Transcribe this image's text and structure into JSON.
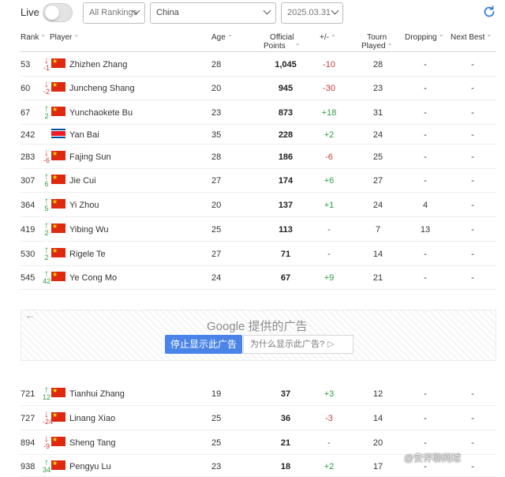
{
  "top": {
    "live_label": "Live",
    "rankings_select": "All Rankings",
    "country_select": "China",
    "date_select": "2025.03.31"
  },
  "headers": {
    "rank": "Rank",
    "player": "Player",
    "age": "Age",
    "points_line1": "Official",
    "points_line2": "Points",
    "delta": "+/-",
    "tourn_line1": "Tourn",
    "tourn_line2": "Played",
    "dropping": "Dropping",
    "next_best": "Next Best"
  },
  "rows": [
    {
      "rank": "53",
      "dir": "down",
      "move": "-1",
      "flag": "cn",
      "player": "Zhizhen Zhang",
      "age": "28",
      "points": "1,045",
      "delta": "-10",
      "tourn": "28",
      "dropping": "-",
      "next_best": "-"
    },
    {
      "rank": "60",
      "dir": "down",
      "move": "-2",
      "flag": "cn",
      "player": "Juncheng Shang",
      "age": "20",
      "points": "945",
      "delta": "-30",
      "tourn": "23",
      "dropping": "-",
      "next_best": "-"
    },
    {
      "rank": "67",
      "dir": "up",
      "move": "2",
      "flag": "cn",
      "player": "Yunchaokete Bu",
      "age": "23",
      "points": "873",
      "delta": "+18",
      "tourn": "31",
      "dropping": "-",
      "next_best": "-"
    },
    {
      "rank": "242",
      "dir": "none",
      "move": "",
      "flag": "kp",
      "player": "Yan Bai",
      "age": "35",
      "points": "228",
      "delta": "+2",
      "tourn": "24",
      "dropping": "-",
      "next_best": "-"
    },
    {
      "rank": "283",
      "dir": "down",
      "move": "-6",
      "flag": "cn",
      "player": "Fajing Sun",
      "age": "28",
      "points": "186",
      "delta": "-6",
      "tourn": "25",
      "dropping": "-",
      "next_best": "-"
    },
    {
      "rank": "307",
      "dir": "up",
      "move": "6",
      "flag": "cn",
      "player": "Jie Cui",
      "age": "27",
      "points": "174",
      "delta": "+6",
      "tourn": "27",
      "dropping": "-",
      "next_best": "-"
    },
    {
      "rank": "364",
      "dir": "up",
      "move": "5",
      "flag": "cn",
      "player": "Yi Zhou",
      "age": "20",
      "points": "137",
      "delta": "+1",
      "tourn": "24",
      "dropping": "4",
      "next_best": "-"
    },
    {
      "rank": "419",
      "dir": "up",
      "move": "2",
      "flag": "cn",
      "player": "Yibing Wu",
      "age": "25",
      "points": "113",
      "delta": "-",
      "tourn": "7",
      "dropping": "13",
      "next_best": "-"
    },
    {
      "rank": "530",
      "dir": "up",
      "move": "2",
      "flag": "cn",
      "player": "Rigele Te",
      "age": "27",
      "points": "71",
      "delta": "-",
      "tourn": "14",
      "dropping": "-",
      "next_best": "-"
    },
    {
      "rank": "545",
      "dir": "up",
      "move": "42",
      "flag": "cn",
      "player": "Ye Cong Mo",
      "age": "24",
      "points": "67",
      "delta": "+9",
      "tourn": "21",
      "dropping": "-",
      "next_best": "-"
    },
    {
      "rank": "721",
      "dir": "up",
      "move": "12",
      "flag": "cn",
      "player": "Tianhui Zhang",
      "age": "19",
      "points": "37",
      "delta": "+3",
      "tourn": "12",
      "dropping": "-",
      "next_best": "-"
    },
    {
      "rank": "727",
      "dir": "down",
      "move": "-24",
      "flag": "cn",
      "player": "Linang Xiao",
      "age": "25",
      "points": "36",
      "delta": "-3",
      "tourn": "14",
      "dropping": "-",
      "next_best": "-"
    },
    {
      "rank": "894",
      "dir": "down",
      "move": "-9",
      "flag": "cn",
      "player": "Sheng Tang",
      "age": "25",
      "points": "21",
      "delta": "-",
      "tourn": "20",
      "dropping": "-",
      "next_best": "-"
    },
    {
      "rank": "938",
      "dir": "up",
      "move": "34",
      "flag": "cn",
      "player": "Pengyu Lu",
      "age": "23",
      "points": "18",
      "delta": "+2",
      "tourn": "17",
      "dropping": "-",
      "next_best": "-"
    }
  ],
  "ad": {
    "title": "Google 提供的广告",
    "stop_button": "停止显示此广告",
    "why_button": "为什么显示此广告?"
  },
  "watermark": "@安评聊网球",
  "colors": {
    "up": "#2e9e3e",
    "down": "#c83c3c",
    "accent": "#4a84e8",
    "refresh": "#3a7be0"
  }
}
